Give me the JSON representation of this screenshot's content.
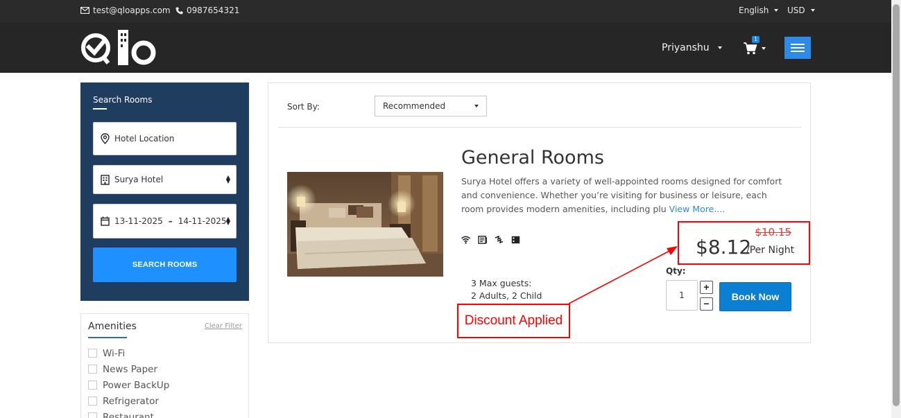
{
  "topbar": {
    "email": "test@qloapps.com",
    "phone": "0987654321",
    "language": "English",
    "currency": "USD"
  },
  "header": {
    "user_name": "Priyanshu",
    "cart_count": "1"
  },
  "search": {
    "title": "Search Rooms",
    "location_placeholder": "Hotel Location",
    "hotel": "Surya Hotel",
    "check_in": "13-11-2025",
    "check_out": "14-11-2025",
    "dash": "–",
    "button_label": "SEARCH ROOMS"
  },
  "amenities": {
    "title": "Amenities",
    "clear_filter": "Clear Filter",
    "items": [
      "Wi-Fi",
      "News Paper",
      "Power BackUp",
      "Refrigerator",
      "Restaurant"
    ]
  },
  "results": {
    "sort_label": "Sort By:",
    "sort_value": "Recommended",
    "room": {
      "title": "General Rooms",
      "description": "Surya Hotel offers a variety of well-appointed rooms designed for comfort and convenience. Whether you’re visiting for business or leisure, each room provides modern amenities, including plu",
      "view_more": "View More....",
      "amenity_icons": [
        "wifi-icon",
        "newspaper-icon",
        "power-icon",
        "refrigerator-icon"
      ],
      "guests_line1": "3 Max guests:",
      "guests_line2": "2 Adults, 2 Child",
      "old_price": "$10.15",
      "price": "$8.12",
      "per_night": "/Per Night",
      "qty_label": "Qty:",
      "qty_value": "1",
      "plus": "+",
      "minus": "−",
      "book_label": "Book Now"
    },
    "annotation": "Discount Applied"
  },
  "colors": {
    "header_bg": "#262626",
    "search_panel_bg": "#1f3d5e",
    "accent_blue": "#1e90ff",
    "annotation_red": "#ff0000"
  }
}
